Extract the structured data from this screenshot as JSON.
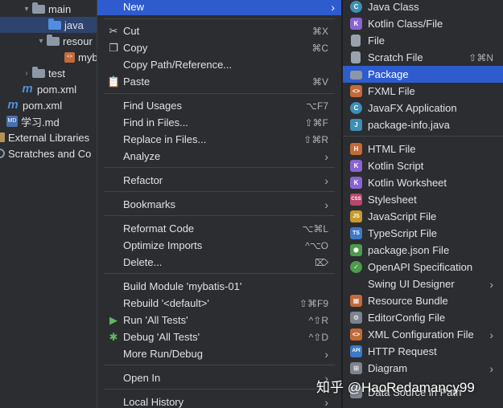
{
  "tree": {
    "items": [
      {
        "label": "main",
        "icon": "folder-icon"
      },
      {
        "label": "java",
        "icon": "source-folder-icon"
      },
      {
        "label": "resour",
        "icon": "resources-folder-icon"
      },
      {
        "label": "myb",
        "icon": "xml-file-icon"
      },
      {
        "label": "test",
        "icon": "folder-icon"
      },
      {
        "label": "pom.xml",
        "icon": "maven-icon"
      },
      {
        "label": "pom.xml",
        "icon": "maven-icon"
      },
      {
        "label": "学习.md",
        "icon": "markdown-icon"
      },
      {
        "label": "External Libraries",
        "icon": "library-icon"
      },
      {
        "label": "Scratches and Co",
        "icon": "scratches-icon"
      }
    ]
  },
  "context_menu": {
    "new": {
      "label": "New"
    },
    "cut": {
      "label": "Cut",
      "shortcut": "⌘X"
    },
    "copy": {
      "label": "Copy",
      "shortcut": "⌘C"
    },
    "copy_path": {
      "label": "Copy Path/Reference..."
    },
    "paste": {
      "label": "Paste",
      "shortcut": "⌘V"
    },
    "find_usages": {
      "label": "Find Usages",
      "shortcut": "⌥F7"
    },
    "find_in_files": {
      "label": "Find in Files...",
      "shortcut": "⇧⌘F"
    },
    "replace_in_files": {
      "label": "Replace in Files...",
      "shortcut": "⇧⌘R"
    },
    "analyze": {
      "label": "Analyze"
    },
    "refactor": {
      "label": "Refactor"
    },
    "bookmarks": {
      "label": "Bookmarks"
    },
    "reformat_code": {
      "label": "Reformat Code",
      "shortcut": "⌥⌘L"
    },
    "optimize_imports": {
      "label": "Optimize Imports",
      "shortcut": "^⌥O"
    },
    "delete": {
      "label": "Delete...",
      "shortcut": "⌦"
    },
    "build_module": {
      "label": "Build Module 'mybatis-01'"
    },
    "rebuild": {
      "label": "Rebuild '<default>'",
      "shortcut": "⇧⌘F9"
    },
    "run_tests": {
      "label": "Run 'All Tests'",
      "shortcut": "^⇧R"
    },
    "debug_tests": {
      "label": "Debug 'All Tests'",
      "shortcut": "^⇧D"
    },
    "more_run": {
      "label": "More Run/Debug"
    },
    "open_in": {
      "label": "Open In"
    },
    "local_history": {
      "label": "Local History"
    }
  },
  "submenu": {
    "items": [
      {
        "label": "Java Class",
        "icon_text": "C",
        "color": "#3d8fb5"
      },
      {
        "label": "Kotlin Class/File",
        "icon_text": "K",
        "color": "#8a63d2"
      },
      {
        "label": "File",
        "icon_text": "",
        "color": "#9aa3ad"
      },
      {
        "label": "Scratch File",
        "icon_text": "",
        "color": "#9aa3ad",
        "shortcut": "⇧⌘N"
      },
      {
        "label": "Package",
        "icon_text": "",
        "color": "#8c98a8"
      },
      {
        "label": "FXML File",
        "icon_text": "<>",
        "color": "#c36a3a"
      },
      {
        "label": "JavaFX Application",
        "icon_text": "C",
        "color": "#3d8fb5"
      },
      {
        "label": "package-info.java",
        "icon_text": "J",
        "color": "#3d8fb5"
      },
      {
        "label": "HTML File",
        "icon_text": "H",
        "color": "#c36a3a"
      },
      {
        "label": "Kotlin Script",
        "icon_text": "K",
        "color": "#8a63d2"
      },
      {
        "label": "Kotlin Worksheet",
        "icon_text": "K",
        "color": "#8a63d2"
      },
      {
        "label": "Stylesheet",
        "icon_text": "CSS",
        "color": "#b8476b"
      },
      {
        "label": "JavaScript File",
        "icon_text": "JS",
        "color": "#c79a2b"
      },
      {
        "label": "TypeScript File",
        "icon_text": "TS",
        "color": "#3d79c4"
      },
      {
        "label": "package.json File",
        "icon_text": "⬢",
        "color": "#4c9a4c"
      },
      {
        "label": "OpenAPI Specification",
        "icon_text": "✓",
        "color": "#4c9a4c"
      },
      {
        "label": "Swing UI Designer",
        "icon_text": "",
        "color": "",
        "has_submenu": true
      },
      {
        "label": "Resource Bundle",
        "icon_text": "▦",
        "color": "#c36a3a"
      },
      {
        "label": "EditorConfig File",
        "icon_text": "⚙",
        "color": "#7d848e"
      },
      {
        "label": "XML Configuration File",
        "icon_text": "<>",
        "color": "#c36a3a",
        "has_submenu": true
      },
      {
        "label": "HTTP Request",
        "icon_text": "API",
        "color": "#3d79c4"
      },
      {
        "label": "Diagram",
        "icon_text": "⊞",
        "color": "#7d848e",
        "has_submenu": true
      },
      {
        "label": "Data Source in Path",
        "icon_text": "",
        "color": "#7d848e"
      }
    ]
  },
  "watermark": {
    "text": "知乎 @HaoRedamancy99"
  },
  "colors": {
    "accent": "#2e5bce",
    "background": "#2b2d30",
    "selected_tree": "#2e436e"
  }
}
